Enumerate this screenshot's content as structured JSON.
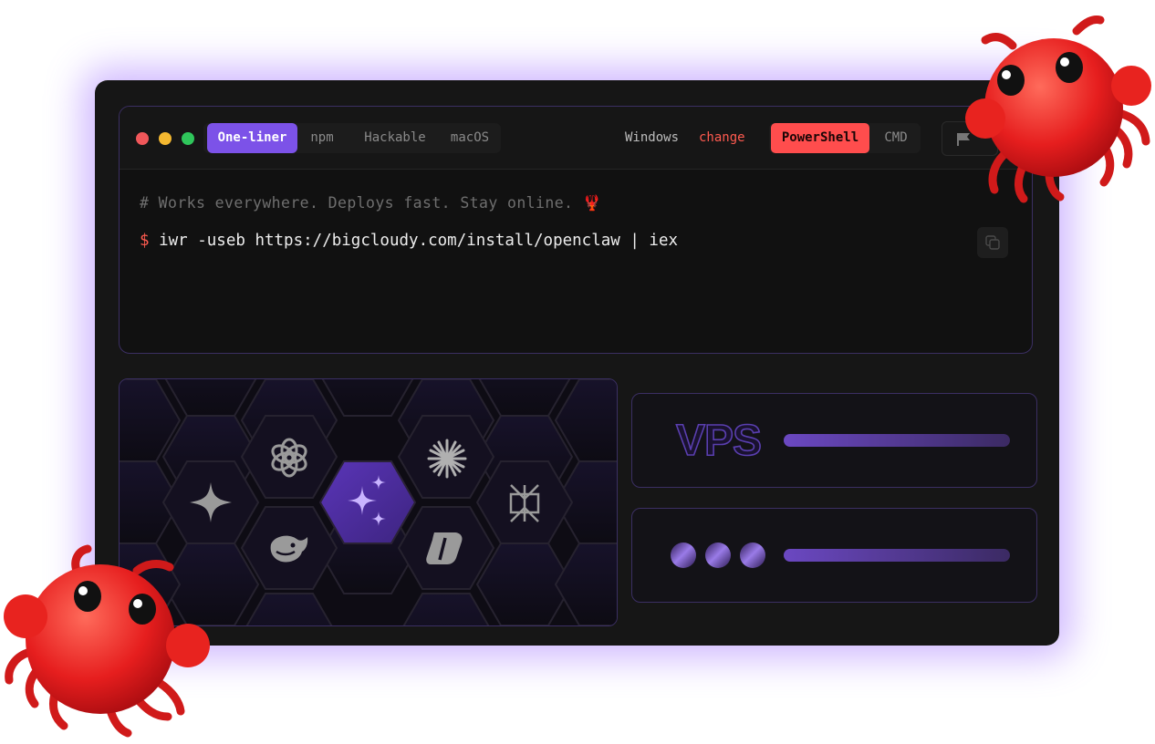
{
  "terminal": {
    "tabs": [
      {
        "label": "One-liner",
        "active": true
      },
      {
        "label": "npm",
        "active": false
      },
      {
        "label": "Hackable",
        "active": false
      },
      {
        "label": "macOS",
        "active": false
      }
    ],
    "os": {
      "label": "Windows",
      "change_label": "change"
    },
    "shells": [
      {
        "label": "PowerShell",
        "active": true
      },
      {
        "label": "CMD",
        "active": false
      }
    ],
    "comment": "# Works everywhere. Deploys fast. Stay online. 🦞",
    "prompt": "$",
    "command": "iwr -useb https://bigcloudy.com/install/openclaw | iex"
  },
  "hosting_cards": [
    {
      "label": "VPS"
    },
    {
      "label": ""
    }
  ],
  "ai_icons": [
    "gemini-icon",
    "openai-icon",
    "claude-icon",
    "perplexity-icon",
    "deepseek-icon",
    "copilot-icon",
    "sparkle-icon"
  ],
  "colors": {
    "accent": "#7c52e8",
    "danger": "#ff4d4d",
    "background": "#161616",
    "border": "#3b2f63"
  }
}
